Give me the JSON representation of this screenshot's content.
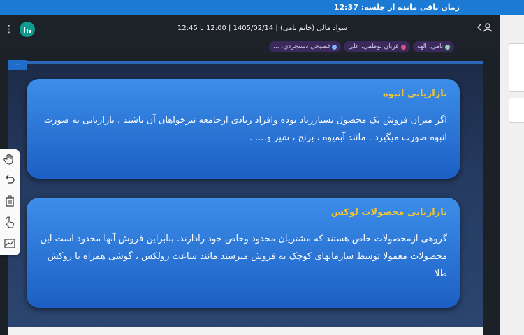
{
  "session": {
    "timer_text": "زمان باقی مانده از جلسه: 12:37"
  },
  "header": {
    "title": "سواد مالی (خانم نامی) | 1405/02/14 | 12:00 تا 12:45"
  },
  "participants": [
    {
      "label": "نامی، الهه",
      "color": "#8fd3b0"
    },
    {
      "label": "قربان لوطفی، علی",
      "color": "#d7557e"
    },
    {
      "label": "فصیحی دستجردی، ...",
      "color": "#7fb4ff"
    }
  ],
  "stage": {
    "badge": "—"
  },
  "cards": [
    {
      "heading": "بازاریابی انبوه",
      "body": "اگر میزان فروش یک محصول بسیارزیاد بوده وافراد زیادی ازجامعه نیزخواهان آن باشند ، بازاریابی به صورت انبوه صورت میگیرد . مانند آبمیوه ، برنج ، شیر و.... ."
    },
    {
      "heading": "بازاریابی محصولات لوکس",
      "body": "گروهی ازمحصولات خاص هستند که مشتریان محدود وخاص خود رادارند. بنابراین فروش آنها محدود است این محصولات معمولا توسط سازمانهای کوچک به فروش میرسند.مانند ساعت رولکس ، گوشی همراه با روکش طلا"
    }
  ],
  "toolbar": {
    "tools": [
      "hand-icon",
      "undo-icon",
      "trash-icon",
      "pointer-hand-icon",
      "chart-line-icon"
    ]
  },
  "colors": {
    "topbar": "#1a7ad4",
    "card_heading": "#f4c431",
    "app_icon": "#0f9b8e"
  }
}
